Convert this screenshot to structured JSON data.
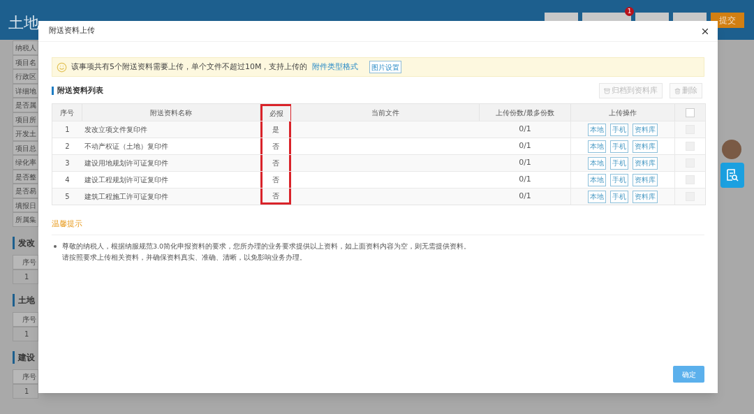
{
  "background": {
    "title": "土地",
    "badge": "1",
    "submit": "提交",
    "form_labels": [
      "纳税人",
      "项目名",
      "行政区",
      "详细地",
      "是否属",
      "项目所",
      "开发土",
      "项目总",
      "绿化率",
      "是否整",
      "是否易",
      "填报日",
      "所属集"
    ],
    "sections": [
      {
        "title": "发改",
        "header": "序号",
        "row": "1"
      },
      {
        "title": "土地",
        "header": "序号",
        "row": "1"
      },
      {
        "title": "建设",
        "header": "序号",
        "row": "1"
      }
    ]
  },
  "dialog": {
    "title": "附送资料上传",
    "notice": {
      "text": "该事项共有5个附送资料需要上传，单个文件不超过10M，支持上传的",
      "link": "附件类型格式",
      "button": "图片设置"
    },
    "list_title": "附送资料列表",
    "toolbar": [
      {
        "label": "归档到资料库",
        "kind": "archive",
        "disabled": true
      },
      {
        "label": "删除",
        "kind": "delete",
        "disabled": true
      }
    ],
    "columns": [
      {
        "label": "序号",
        "highlighted": false
      },
      {
        "label": "附送资料名称",
        "highlighted": false
      },
      {
        "label": "必报",
        "highlighted": true
      },
      {
        "label": "当前文件",
        "highlighted": false
      },
      {
        "label": "上传份数/最多份数",
        "highlighted": false
      },
      {
        "label": "上传操作",
        "highlighted": false
      }
    ],
    "header_checkbox": {
      "checked": false
    },
    "rows": [
      {
        "index": "1",
        "name": "发改立项文件复印件",
        "required": "是",
        "count": "0/1",
        "actions": [
          "本地",
          "手机",
          "资料库"
        ],
        "checked": false,
        "disabled": true
      },
      {
        "index": "2",
        "name": "不动产权证（土地）复印件",
        "required": "否",
        "count": "0/1",
        "actions": [
          "本地",
          "手机",
          "资料库"
        ],
        "checked": false,
        "disabled": true
      },
      {
        "index": "3",
        "name": "建设用地规划许可证复印件",
        "required": "否",
        "count": "0/1",
        "actions": [
          "本地",
          "手机",
          "资料库"
        ],
        "checked": false,
        "disabled": true
      },
      {
        "index": "4",
        "name": "建设工程规划许可证复印件",
        "required": "否",
        "count": "0/1",
        "actions": [
          "本地",
          "手机",
          "资料库"
        ],
        "checked": false,
        "disabled": true
      },
      {
        "index": "5",
        "name": "建筑工程施工许可证复印件",
        "required": "否",
        "count": "0/1",
        "actions": [
          "本地",
          "手机",
          "资料库"
        ],
        "checked": false,
        "disabled": true
      }
    ],
    "tips": {
      "title": "温馨提示",
      "items": [
        {
          "lines": [
            "尊敬的纳税人，根据纳服规范3.0简化申报资料的要求，您所办理的业务要求提供以上资料，如上面资料内容为空，则无需提供资料。",
            "请按照要求上传相关资料，并确保资料真实、准确、清晰，以免影响业务办理。"
          ]
        }
      ]
    },
    "confirm": "确定"
  }
}
